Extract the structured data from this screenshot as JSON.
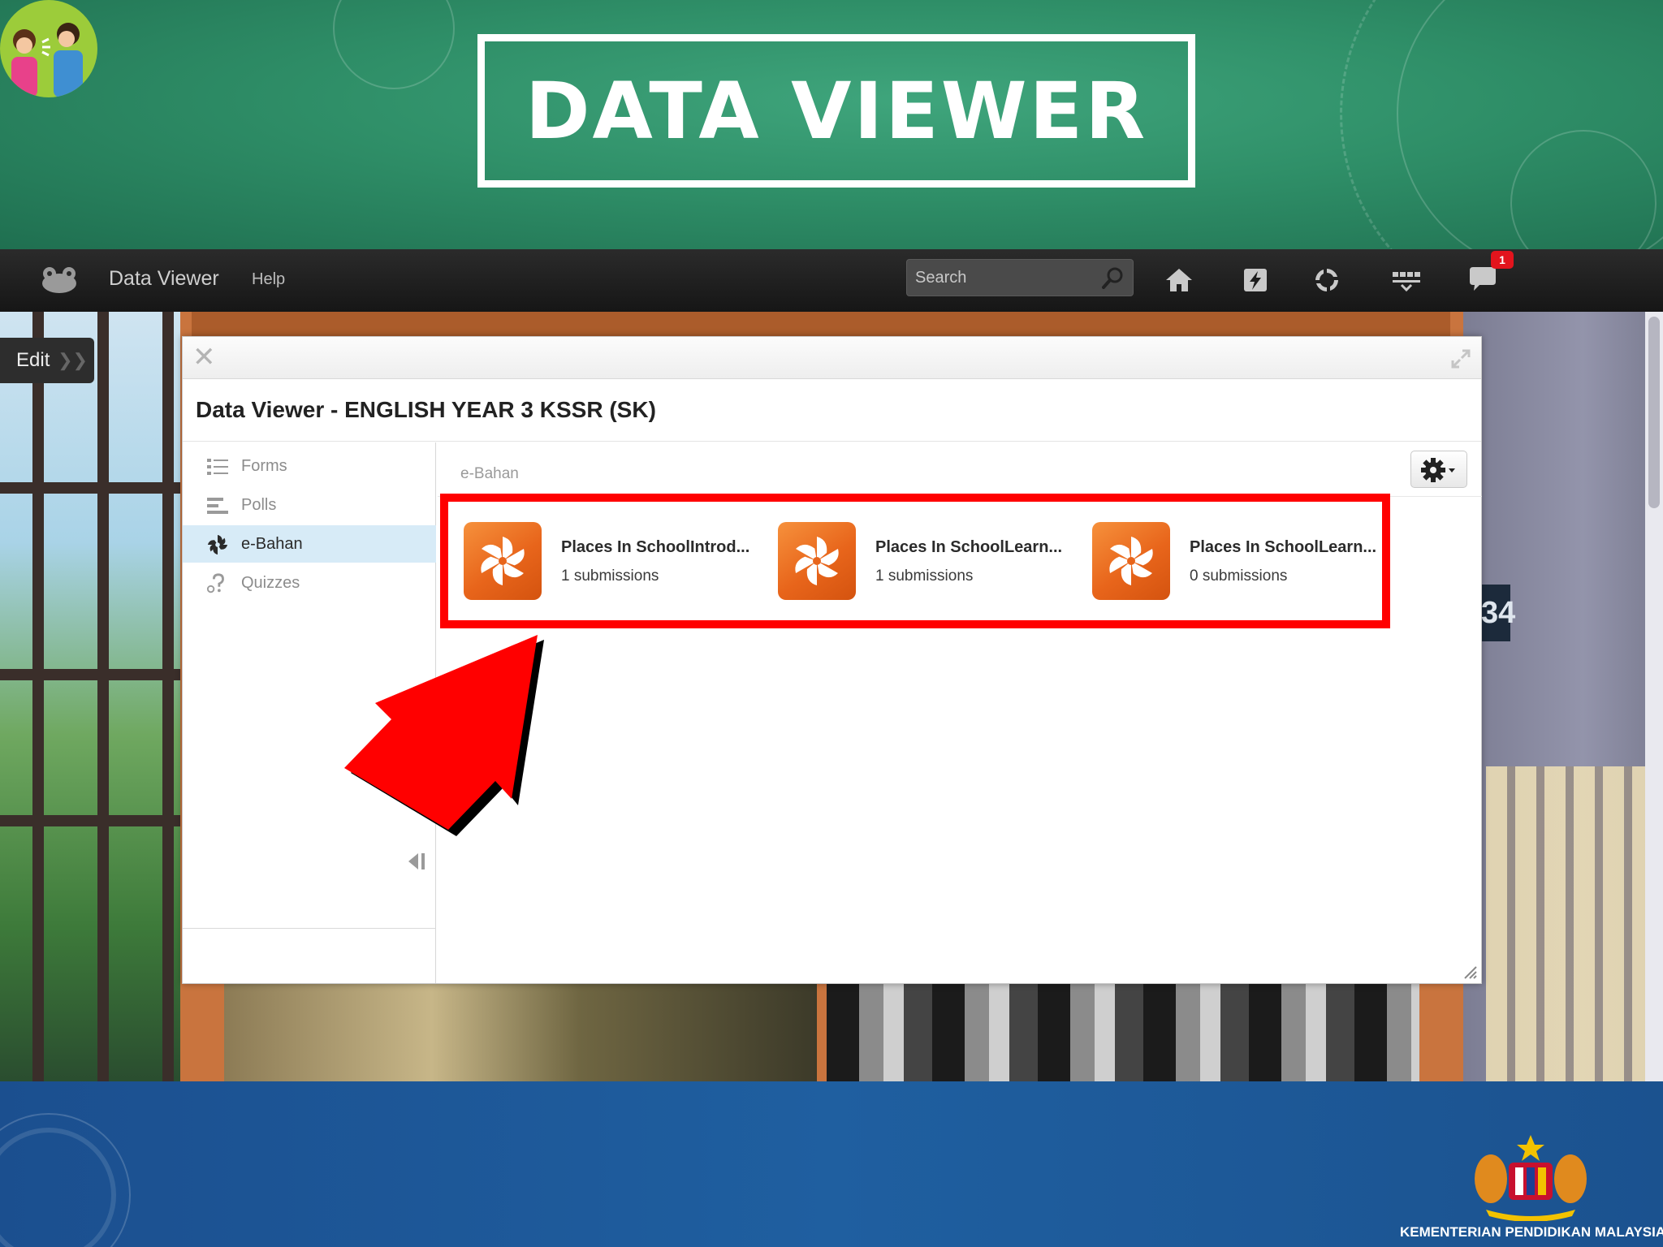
{
  "slide": {
    "title": "DATA VIEWER",
    "ministry_label": "KEMENTERIAN PENDIDIKAN MALAYSIA"
  },
  "topbar": {
    "app_title": "Data Viewer",
    "help_label": "Help",
    "search_placeholder": "Search",
    "notification_count": "1",
    "icons": [
      "home-icon",
      "lightning-icon",
      "sync-icon",
      "dashboard-icon",
      "chat-icon"
    ]
  },
  "scene": {
    "edit_label": "Edit",
    "room_number": "34"
  },
  "dialog": {
    "title": "Data Viewer - ENGLISH YEAR 3 KSSR (SK)",
    "sidebar": {
      "items": [
        {
          "label": "Forms",
          "icon": "list-icon",
          "active": false
        },
        {
          "label": "Polls",
          "icon": "bars-icon",
          "active": false
        },
        {
          "label": "e-Bahan",
          "icon": "pinwheel-icon",
          "active": true
        },
        {
          "label": "Quizzes",
          "icon": "question-icon",
          "active": false
        }
      ]
    },
    "content": {
      "section_label": "e-Bahan",
      "items": [
        {
          "name": "Places In SchoolIntrod...",
          "submissions": "1 submissions"
        },
        {
          "name": "Places In SchoolLearn...",
          "submissions": "1 submissions"
        },
        {
          "name": "Places In SchoolLearn...",
          "submissions": "0 submissions"
        }
      ]
    }
  },
  "colors": {
    "banner": "#2f8f68",
    "appbar": "#1c1c1c",
    "highlight": "#ff0000",
    "item_icon": "#e8651b",
    "active_nav": "#d7ebf7",
    "footer": "#1f5fa0"
  }
}
